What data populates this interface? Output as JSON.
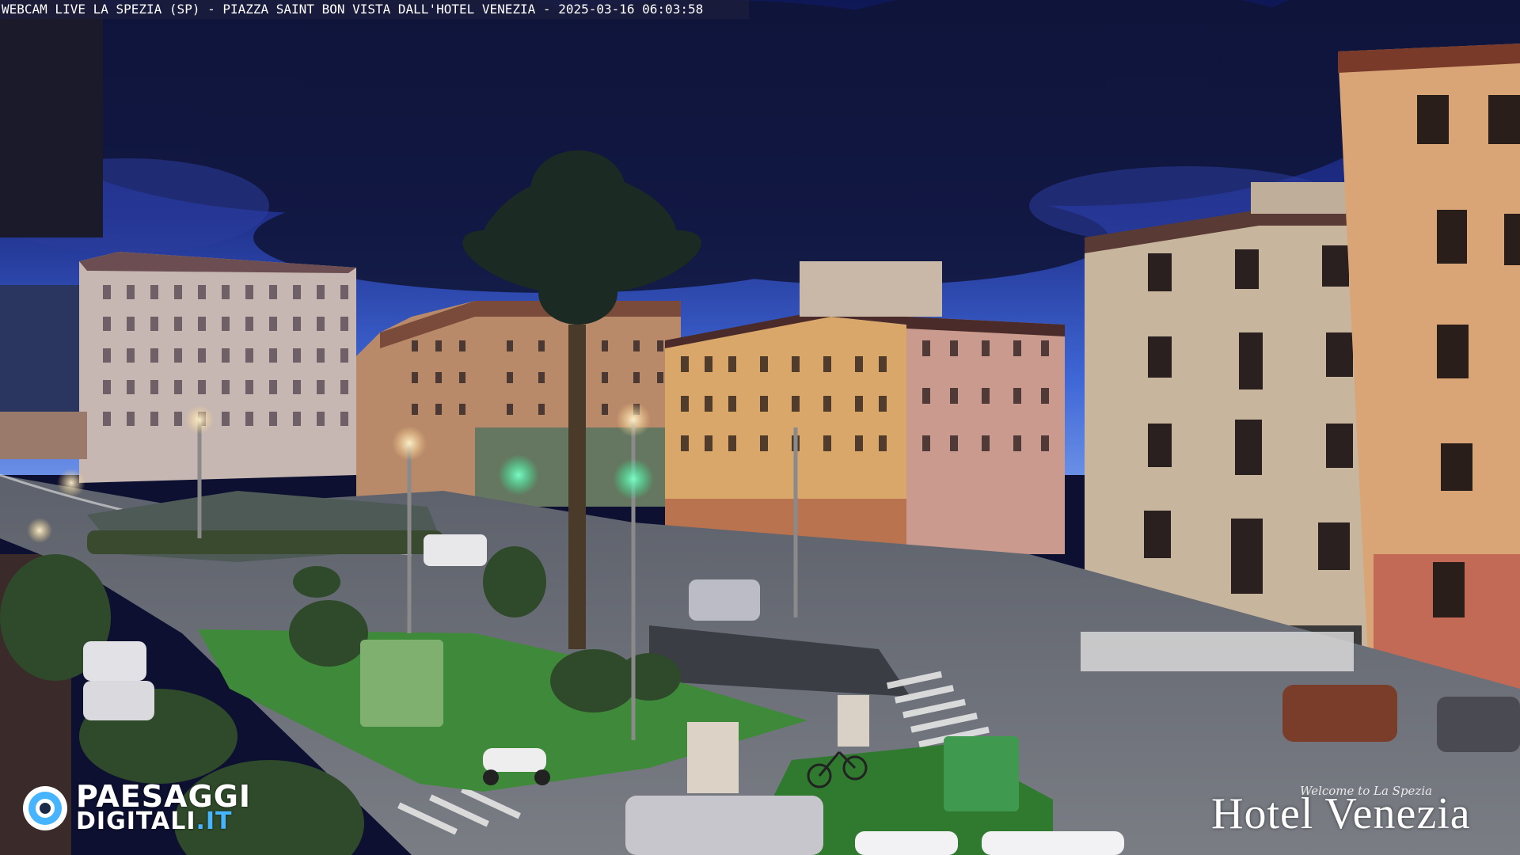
{
  "overlay": {
    "caption": "WEBCAM LIVE LA SPEZIA (SP) - PIAZZA SAINT BON VISTA DALL'HOTEL VENEZIA - 2025-03-16 06:03:58"
  },
  "logos": {
    "paesaggi_line1": "PAESAGGI",
    "paesaggi_line2_main": "DIGITALI",
    "paesaggi_line2_suffix": ".IT",
    "hotel_tagline": "Welcome to La Spezia",
    "hotel_name": "Hotel Venezia"
  },
  "colors": {
    "sky_top": "#101a5e",
    "sky_horizon": "#3f67d6",
    "cloud": "#0f1436",
    "grass": "#3f8a3a",
    "road": "#6b6f78",
    "traffic_light_green": "#2bff9a",
    "brand_blue": "#46b4ff"
  }
}
